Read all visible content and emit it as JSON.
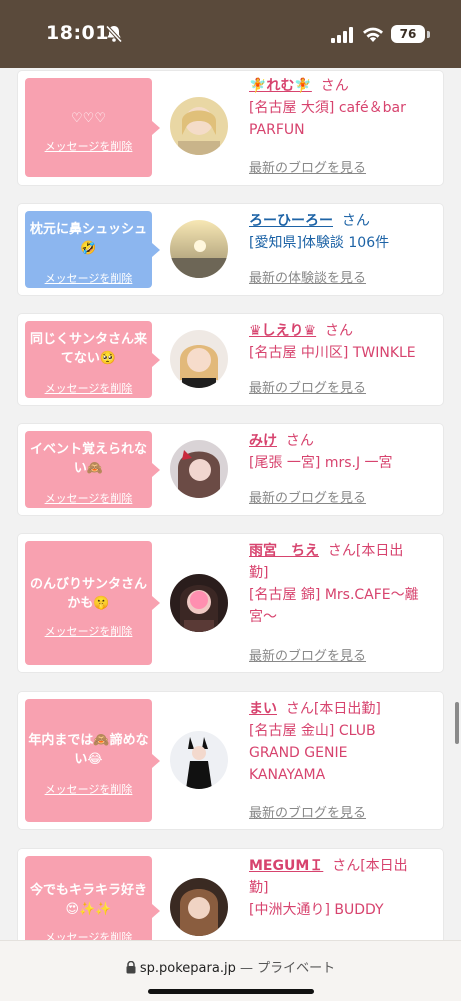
{
  "status_bar": {
    "time": "18:01",
    "battery": "76"
  },
  "common": {
    "san": "さん",
    "delete_label": "メッセージを削除"
  },
  "cards": [
    {
      "message": "♡♡♡",
      "name": "🧚れむ🧚",
      "san": "さん",
      "shop_lines": [
        "[名古屋 大須] café＆bar",
        "PARFUN"
      ],
      "more": "最新のブログを見る"
    },
    {
      "message": "枕元に鼻シュッシュ🤣",
      "name": "ろーひーろー",
      "san": "さん",
      "shop_lines": [
        "[愛知県]体験談 106件"
      ],
      "more": "最新の体験談を見る"
    },
    {
      "message": "同じくサンタさん来てない🥺",
      "name": "♛しえり♛",
      "san": "さん",
      "shop_lines": [
        "[名古屋 中川区] TWINKLE"
      ],
      "more": "最新のブログを見る"
    },
    {
      "message": "イベント覚えられない🙈",
      "name": "みけ",
      "san": "さん",
      "shop_lines": [
        "[尾張 一宮] mrs.J 一宮"
      ],
      "more": "最新のブログを見る"
    },
    {
      "message": "のんびりサンタさんかも🤫",
      "name": "雨宮　ちえ",
      "san": "さん[本日出",
      "name_line2": "勤]",
      "shop_lines": [
        "[名古屋 錦] Mrs.CAFE〜離",
        "宮〜"
      ],
      "more": "最新のブログを見る"
    },
    {
      "message": "年内までは🙈諦めない😂",
      "name": "まい",
      "san": "さん[本日出勤]",
      "shop_lines": [
        "[名古屋 金山] CLUB",
        "GRAND GENIE",
        "KANAYAMA"
      ],
      "more": "最新のブログを見る"
    },
    {
      "message": "今でもキラキラ好き😍✨✨",
      "name": "MEGUMＩ",
      "san": "さん[本日出",
      "name_line2": "勤]",
      "shop_lines": [
        "[中洲大通り] BUDDY"
      ],
      "more": ""
    }
  ],
  "url_bar": {
    "domain": "sp.pokepara.jp",
    "separator": "—",
    "private": "プライベート"
  },
  "colors": {
    "header": "#5a4a3b",
    "pink_bubble": "#f8a1b0",
    "blue_bubble": "#8cb6ef",
    "name_pink": "#d7436e",
    "name_blue": "#1d63a6"
  }
}
